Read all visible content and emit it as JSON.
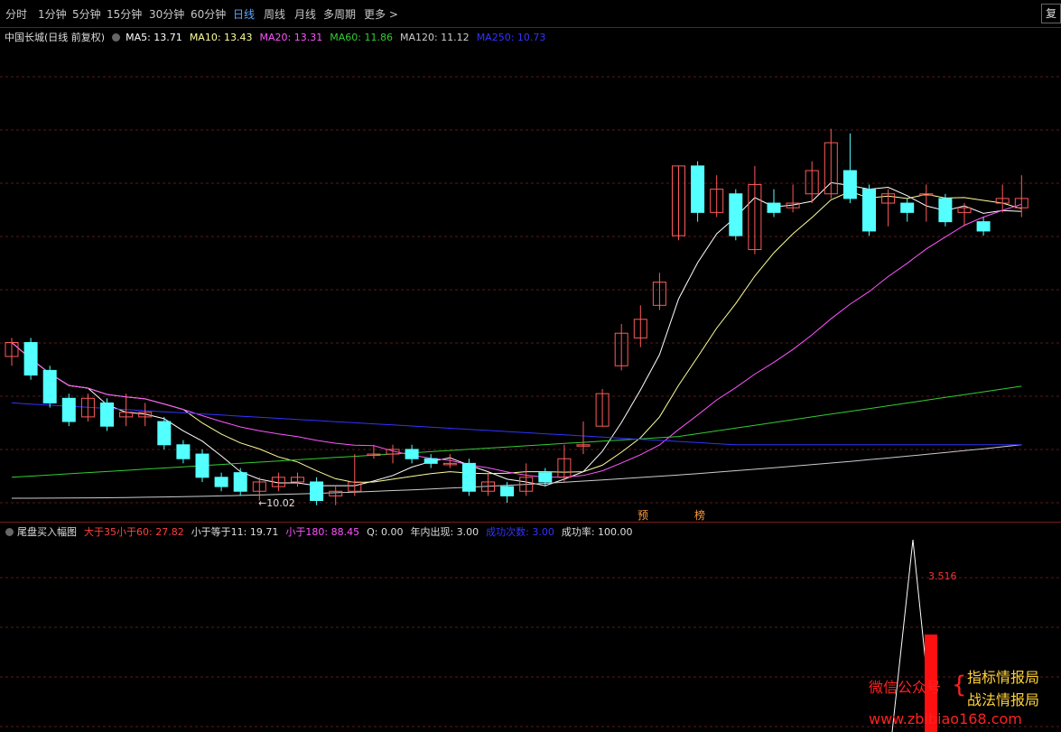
{
  "toolbar": {
    "tabs": [
      "分时",
      "1分钟",
      "5分钟",
      "15分钟",
      "30分钟",
      "60分钟",
      "日线",
      "周线",
      "月线",
      "多周期",
      "更多 >"
    ],
    "active": "日线",
    "right_button": "复"
  },
  "info": {
    "stock": "中国长城(日线 前复权)",
    "ma5": "MA5: 13.71",
    "ma10": "MA10: 13.43",
    "ma20": "MA20: 13.31",
    "ma60": "MA60: 11.86",
    "ma120": "MA120: 11.12",
    "ma250": "MA250: 10.73"
  },
  "colors": {
    "up": "#ff5a5a",
    "down": "#54ffff",
    "ma5": "#ffffff",
    "ma10": "#ffff99",
    "ma20": "#ff55ff",
    "ma60": "#33cc33",
    "ma120": "#cccccc",
    "ma250": "#3333ff",
    "grid": "#5a1a1a"
  },
  "price_low_label": "←10.02",
  "markers": {
    "yu": "预",
    "bang": "榜"
  },
  "indicator": {
    "name": "尾盘买入幅图",
    "a": "大于35小于60: 27.82",
    "b": "小于等于11: 19.71",
    "c": "小于180: 88.45",
    "q": "Q: 0.00",
    "year": "年内出现: 3.00",
    "succ_count": "成功次数: 3.00",
    "rate": "成功率: 100.00",
    "peak_label": "3.516"
  },
  "watermark": {
    "wechat": "微信公众号",
    "line1": "指标情报局",
    "line2": "战法情报局",
    "url": "www.zbibiao168.com"
  },
  "chart_data": {
    "type": "candlestick",
    "candles": [
      [
        13.1,
        13.4,
        12.9,
        13.5
      ],
      [
        13.4,
        12.7,
        12.6,
        13.5
      ],
      [
        12.8,
        12.1,
        12.0,
        12.9
      ],
      [
        12.2,
        11.7,
        11.6,
        12.3
      ],
      [
        11.8,
        12.2,
        11.7,
        12.3
      ],
      [
        12.1,
        11.6,
        11.5,
        12.2
      ],
      [
        11.8,
        11.9,
        11.6,
        12.3
      ],
      [
        11.8,
        11.9,
        11.6,
        12.1
      ],
      [
        11.7,
        11.2,
        11.1,
        11.8
      ],
      [
        11.2,
        10.9,
        10.8,
        11.3
      ],
      [
        11.0,
        10.5,
        10.4,
        11.1
      ],
      [
        10.5,
        10.3,
        10.2,
        10.6
      ],
      [
        10.6,
        10.2,
        10.1,
        10.7
      ],
      [
        10.2,
        10.4,
        10.0,
        10.5
      ],
      [
        10.3,
        10.5,
        10.2,
        10.6
      ],
      [
        10.4,
        10.5,
        10.3,
        10.6
      ],
      [
        10.4,
        10.0,
        9.9,
        10.5
      ],
      [
        10.1,
        10.2,
        9.9,
        10.3
      ],
      [
        10.2,
        10.4,
        10.1,
        11.0
      ],
      [
        11.0,
        11.0,
        10.9,
        11.2
      ],
      [
        11.0,
        11.1,
        10.8,
        11.2
      ],
      [
        11.1,
        10.9,
        10.8,
        11.2
      ],
      [
        10.9,
        10.8,
        10.7,
        11.0
      ],
      [
        10.8,
        10.8,
        10.7,
        11.0
      ],
      [
        10.8,
        10.2,
        10.1,
        10.9
      ],
      [
        10.2,
        10.4,
        10.1,
        10.6
      ],
      [
        10.3,
        10.1,
        9.95,
        10.4
      ],
      [
        10.2,
        10.5,
        10.1,
        10.8
      ],
      [
        10.6,
        10.4,
        10.3,
        10.7
      ],
      [
        10.5,
        10.9,
        10.4,
        11.2
      ],
      [
        11.2,
        11.2,
        11.0,
        11.7
      ],
      [
        11.6,
        12.3,
        11.6,
        12.4
      ],
      [
        12.9,
        13.6,
        12.8,
        13.8
      ],
      [
        13.5,
        13.9,
        13.3,
        14.2
      ],
      [
        14.2,
        14.7,
        14.1,
        14.9
      ],
      [
        15.7,
        17.2,
        15.6,
        17.2
      ],
      [
        17.2,
        16.2,
        16.0,
        17.3
      ],
      [
        16.2,
        16.7,
        16.1,
        17.0
      ],
      [
        16.6,
        15.7,
        15.6,
        16.7
      ],
      [
        15.4,
        16.8,
        15.3,
        17.2
      ],
      [
        16.4,
        16.2,
        16.1,
        16.7
      ],
      [
        16.3,
        16.4,
        16.2,
        16.8
      ],
      [
        16.6,
        17.1,
        16.4,
        17.3
      ],
      [
        16.6,
        17.7,
        16.5,
        18.0
      ],
      [
        17.1,
        16.5,
        16.4,
        17.9
      ],
      [
        16.7,
        15.8,
        15.7,
        16.8
      ],
      [
        16.4,
        16.6,
        15.9,
        16.7
      ],
      [
        16.4,
        16.2,
        16.0,
        16.5
      ],
      [
        16.6,
        16.6,
        16.0,
        16.8
      ],
      [
        16.5,
        16.0,
        15.9,
        16.6
      ],
      [
        16.2,
        16.3,
        15.9,
        16.4
      ],
      [
        16.0,
        15.8,
        15.7,
        16.1
      ],
      [
        16.4,
        16.5,
        16.2,
        16.8
      ],
      [
        16.3,
        16.5,
        16.1,
        17.0
      ]
    ]
  }
}
